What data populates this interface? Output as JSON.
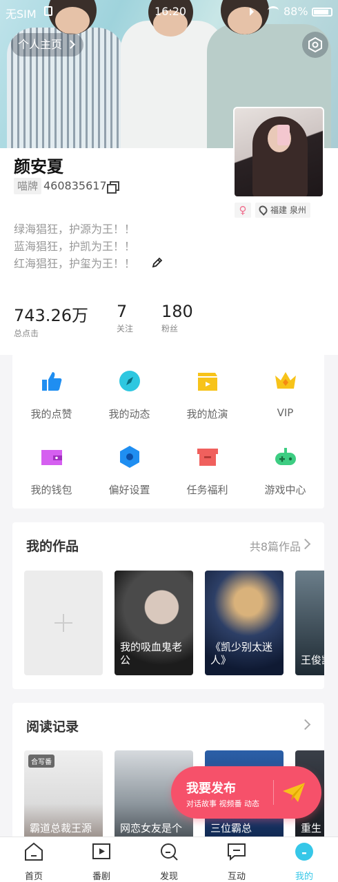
{
  "status_bar": {
    "carrier": "无SIM",
    "time": "16:20",
    "battery": "88%"
  },
  "header": {
    "homepage_label": "个人主页"
  },
  "profile": {
    "name": "颜安夏",
    "tag": "喵牌",
    "uid": "460835617",
    "gender_symbol": "♀",
    "location": "福建 泉州",
    "bio": [
      "绿海猖狂，护源为王！！",
      "蓝海猖狂，护凯为王！！",
      "红海猖狂，护玺为王！！"
    ]
  },
  "stats": [
    {
      "value": "743.26万",
      "label": "总点击"
    },
    {
      "value": "7",
      "label": "关注"
    },
    {
      "value": "180",
      "label": "粉丝"
    }
  ],
  "menu": [
    {
      "label": "我的点赞",
      "icon": "thumbs-up-icon",
      "color": "#1f8ef1"
    },
    {
      "label": "我的动态",
      "icon": "compass-icon",
      "color": "#2ec7e0"
    },
    {
      "label": "我的尬演",
      "icon": "clapperboard-icon",
      "color": "#f7c31a"
    },
    {
      "label": "VIP",
      "icon": "crown-icon",
      "color": "#f7c31a"
    },
    {
      "label": "我的钱包",
      "icon": "wallet-icon",
      "color": "#d55ff0"
    },
    {
      "label": "偏好设置",
      "icon": "hexagon-settings-icon",
      "color": "#1f8ef1"
    },
    {
      "label": "任务福利",
      "icon": "gift-box-icon",
      "color": "#f0605d"
    },
    {
      "label": "游戏中心",
      "icon": "gamepad-icon",
      "color": "#3dcd82"
    }
  ],
  "works": {
    "title": "我的作品",
    "count_label": "共8篇作品",
    "items": [
      {
        "caption": "我的吸血鬼老公"
      },
      {
        "caption": "《凯少别太迷人》"
      },
      {
        "caption": "王俊凯论群"
      }
    ]
  },
  "reading": {
    "title": "阅读记录",
    "items": [
      {
        "caption": "霸道总裁王源",
        "badge": "合写番"
      },
      {
        "caption": "网恋女友是个"
      },
      {
        "caption": "三位霸总"
      },
      {
        "caption": "重生"
      }
    ]
  },
  "publish": {
    "title": "我要发布",
    "subtitle": "对话故事 视频番 动态"
  },
  "tabbar": [
    {
      "label": "首页",
      "icon": "home-icon"
    },
    {
      "label": "番剧",
      "icon": "play-icon"
    },
    {
      "label": "发现",
      "icon": "search-icon"
    },
    {
      "label": "互动",
      "icon": "chat-icon"
    },
    {
      "label": "我的",
      "icon": "profile-icon",
      "active": true
    }
  ],
  "colors": {
    "accent": "#36c7e8",
    "publish": "#f6516a"
  }
}
